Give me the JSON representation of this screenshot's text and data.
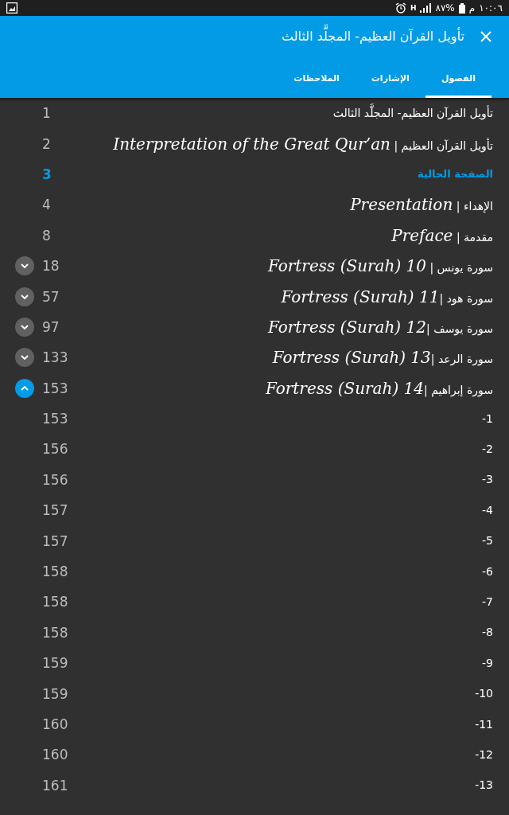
{
  "status_bar": {
    "time": "١٠:٠٦",
    "period": "م",
    "battery": "٨٧%",
    "network": "H"
  },
  "header": {
    "title": "تأويل القرآن العظيم- المجلَّد الثالث"
  },
  "tabs": [
    {
      "label": "الفصول",
      "selected": true
    },
    {
      "label": "الإشارات",
      "selected": false
    },
    {
      "label": "الملاحظات",
      "selected": false
    }
  ],
  "chapters": [
    {
      "kind": "entry",
      "page": "1",
      "title": "تأويل القرآن العظيم- المجلَّد الثالث"
    },
    {
      "kind": "entry",
      "page": "2",
      "title": "تأويل القرآن العظيم | *Interpretation of the Great Qur’an*"
    },
    {
      "kind": "current",
      "page": "3",
      "title": "الصفحة الحالية"
    },
    {
      "kind": "entry",
      "page": "4",
      "title": "الإهداء | *Presentation*"
    },
    {
      "kind": "entry",
      "page": "8",
      "title": "مقدمة | *Preface*"
    },
    {
      "kind": "entry",
      "page": "18",
      "title": "سورة يونس | *Fortress (Surah) 10*",
      "expanded": false
    },
    {
      "kind": "entry",
      "page": "57",
      "title": "سورة هود |*Fortress (Surah) 11*",
      "expanded": false
    },
    {
      "kind": "entry",
      "page": "97",
      "title": "سورة يوسف |*Fortress (Surah) 12*",
      "expanded": false
    },
    {
      "kind": "entry",
      "page": "133",
      "title": "سورة الرعد |*Fortress (Surah) 13*",
      "expanded": false
    },
    {
      "kind": "entry",
      "page": "153",
      "title": "سورة إبراهيم |*Fortress (Surah) 14*",
      "expanded": true
    },
    {
      "kind": "entry",
      "page": "153",
      "title": "-1"
    },
    {
      "kind": "entry",
      "page": "156",
      "title": "-2"
    },
    {
      "kind": "entry",
      "page": "156",
      "title": "-3"
    },
    {
      "kind": "entry",
      "page": "157",
      "title": "-4"
    },
    {
      "kind": "entry",
      "page": "157",
      "title": "-5"
    },
    {
      "kind": "entry",
      "page": "158",
      "title": "-6"
    },
    {
      "kind": "entry",
      "page": "158",
      "title": "-7"
    },
    {
      "kind": "entry",
      "page": "158",
      "title": "-8"
    },
    {
      "kind": "entry",
      "page": "159",
      "title": "-9"
    },
    {
      "kind": "entry",
      "page": "159",
      "title": "-10"
    },
    {
      "kind": "entry",
      "page": "160",
      "title": "-11"
    },
    {
      "kind": "entry",
      "page": "160",
      "title": "-12"
    },
    {
      "kind": "entry",
      "page": "161",
      "title": "-13"
    }
  ]
}
